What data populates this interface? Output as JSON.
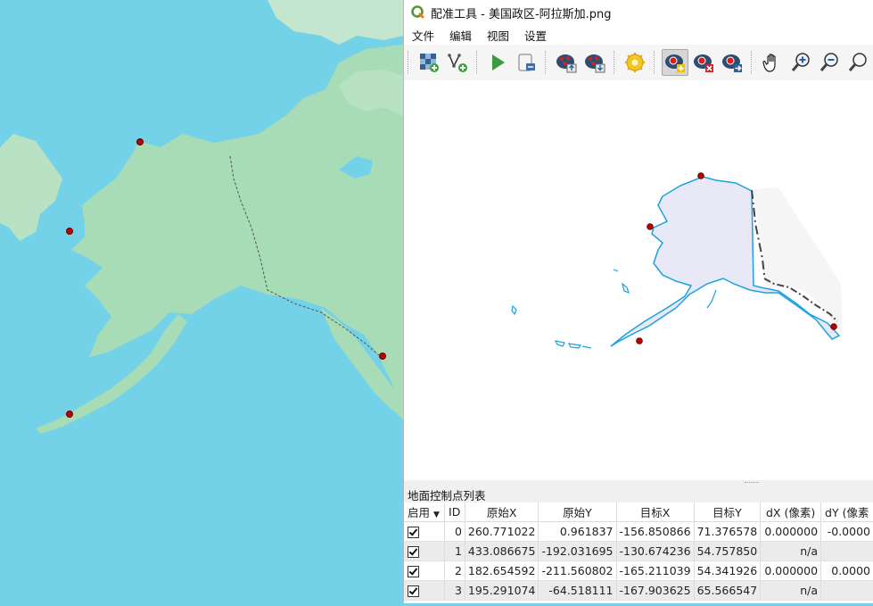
{
  "window": {
    "title": "配准工具 - 美国政区-阿拉斯加.png"
  },
  "menu": [
    {
      "label": "文件"
    },
    {
      "label": "编辑"
    },
    {
      "label": "视图"
    },
    {
      "label": "设置"
    }
  ],
  "toolbar": {
    "tools": [
      {
        "icon": "open-raster-icon"
      },
      {
        "icon": "open-vector-icon"
      },
      {
        "icon": "start-georeferencing-icon"
      },
      {
        "icon": "generate-script-icon"
      },
      {
        "icon": "load-gcp-icon"
      },
      {
        "icon": "save-gcp-icon"
      },
      {
        "icon": "transformation-settings-icon"
      },
      {
        "icon": "add-point-icon",
        "active": true
      },
      {
        "icon": "delete-point-icon"
      },
      {
        "icon": "move-point-icon"
      },
      {
        "icon": "pan-icon"
      },
      {
        "icon": "zoom-in-icon"
      },
      {
        "icon": "zoom-out-icon"
      },
      {
        "icon": "zoom-to-layer-icon"
      }
    ]
  },
  "gcp_panel": {
    "title": "地面控制点列表",
    "columns": [
      "启用",
      "ID",
      "原始X",
      "原始Y",
      "目标X",
      "目标Y",
      "dX (像素)",
      "dY (像素"
    ],
    "rows": [
      {
        "enabled": true,
        "id": "0",
        "src_x": "260.771022",
        "src_y": "0.961837",
        "dst_x": "-156.850866",
        "dst_y": "71.376578",
        "dx": "0.000000",
        "dy": "-0.0000"
      },
      {
        "enabled": true,
        "id": "1",
        "src_x": "433.086675",
        "src_y": "-192.031695",
        "dst_x": "-130.674236",
        "dst_y": "54.757850",
        "dx": "n/a",
        "dy": ""
      },
      {
        "enabled": true,
        "id": "2",
        "src_x": "182.654592",
        "src_y": "-211.560802",
        "dst_x": "-165.211039",
        "dst_y": "54.341926",
        "dx": "0.000000",
        "dy": "0.0000"
      },
      {
        "enabled": true,
        "id": "3",
        "src_x": "195.291074",
        "src_y": "-64.518111",
        "dst_x": "-167.903625",
        "dst_y": "65.566547",
        "dx": "n/a",
        "dy": ""
      }
    ]
  },
  "colors": {
    "ocean": "#74d2e8",
    "land": "#a8dcb6",
    "outline": "#1aa3e0",
    "fill": "#e9e8f6",
    "gcp_point": "#c00000"
  }
}
